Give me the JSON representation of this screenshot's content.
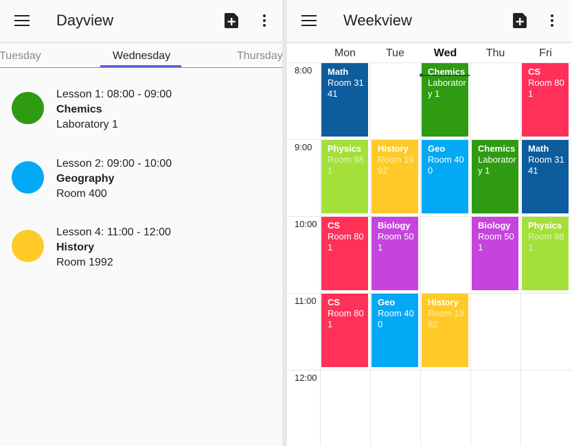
{
  "dayview": {
    "title": "Dayview",
    "tabs": {
      "prev": "Tuesday",
      "current": "Wednesday",
      "next": "Thursday"
    },
    "lessons": [
      {
        "time": "Lesson 1: 08:00 - 09:00",
        "subject": "Chemics",
        "room": "Laboratory 1",
        "color": "#2E9B12"
      },
      {
        "time": "Lesson 2: 09:00 - 10:00",
        "subject": "Geography",
        "room": "Room 400",
        "color": "#03A9F4"
      },
      {
        "time": "Lesson 4: 11:00 - 12:00",
        "subject": "History",
        "room": "Room 1992",
        "color": "#FFCA28"
      }
    ]
  },
  "weekview": {
    "title": "Weekview",
    "days": [
      "Mon",
      "Tue",
      "Wed",
      "Thu",
      "Fri"
    ],
    "today": "Wed",
    "times": [
      "8:00",
      "9:00",
      "10:00",
      "11:00",
      "12:00"
    ],
    "events": {
      "mon_8": {
        "title": "Math",
        "room": "Room 3141"
      },
      "wed_8": {
        "title": "Chemics",
        "room": "Laboratory 1"
      },
      "fri_8": {
        "title": "CS",
        "room": "Room 801"
      },
      "mon_9": {
        "title": "Physics",
        "room": "Room 981"
      },
      "tue_9": {
        "title": "History",
        "room": "Room 1992"
      },
      "wed_9": {
        "title": "Geo",
        "room": "Room 400"
      },
      "thu_9": {
        "title": "Chemics",
        "room": "Laboratory 1"
      },
      "fri_9": {
        "title": "Math",
        "room": "Room 3141"
      },
      "mon_10": {
        "title": "CS",
        "room": "Room 801"
      },
      "tue_10": {
        "title": "Biology",
        "room": "Room 501"
      },
      "thu_10": {
        "title": "Biology",
        "room": "Room 501"
      },
      "fri_10": {
        "title": "Physics",
        "room": "Room 981"
      },
      "mon_11": {
        "title": "CS",
        "room": "Room 801"
      },
      "tue_11": {
        "title": "Geo",
        "room": "Room 400"
      },
      "wed_11": {
        "title": "History",
        "room": "Room 1992"
      }
    }
  },
  "colors": {
    "math": "#0D5C9E",
    "chemics": "#2E9B12",
    "cs": "#FF3158",
    "physics": "#A4E03A",
    "history": "#FFCA28",
    "geo": "#03A9F4",
    "biology": "#C643DD",
    "accent": "#5C5FE0"
  },
  "icons": {
    "menu": "hamburger-menu",
    "add": "calendar-plus",
    "more": "vertical-ellipsis"
  }
}
